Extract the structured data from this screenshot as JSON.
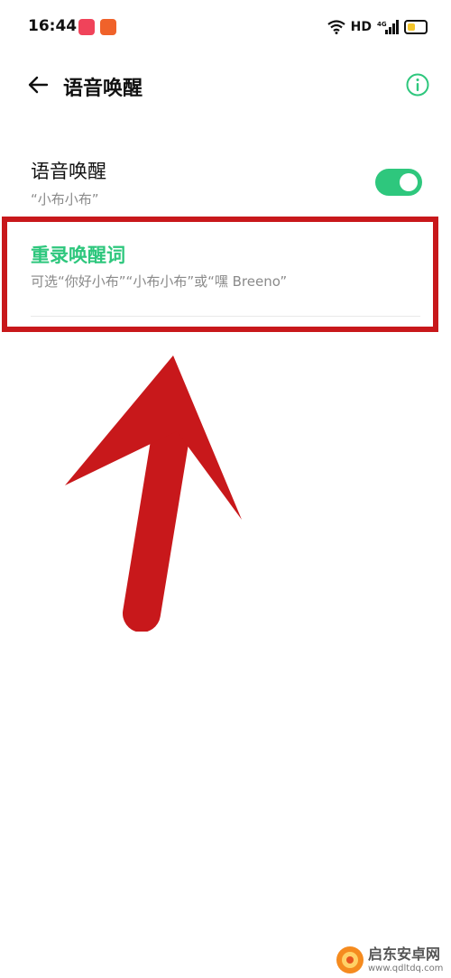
{
  "status_bar": {
    "time": "16:44",
    "hd_label": "HD",
    "signal_label": "4G",
    "battery_color": "#f3c52b"
  },
  "header": {
    "back_icon": "arrow-left-icon",
    "title": "语音唤醒",
    "info_icon": "info-circle-icon"
  },
  "settings": {
    "voice_wakeup": {
      "title": "语音唤醒",
      "subtitle": "“小布小布”",
      "toggle_on": true
    },
    "rerecord": {
      "title": "重录唤醒词",
      "subtitle": "可选“你好小布”“小布小布”或“嘿 Breeno”"
    }
  },
  "annotation": {
    "box_color": "#c8181b",
    "arrow_color": "#c8181b"
  },
  "watermark": {
    "name": "启东安卓网",
    "url": "www.qdltdq.com"
  },
  "colors": {
    "accent": "#2ec77d",
    "text": "#111111",
    "secondary_text": "#8a8a8a"
  }
}
